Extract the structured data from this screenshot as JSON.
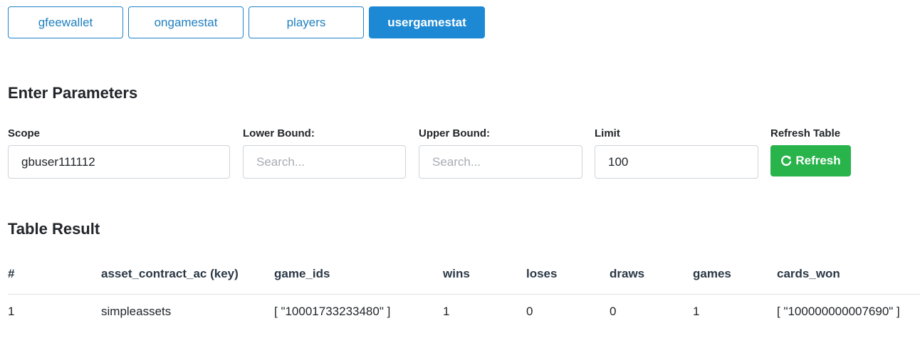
{
  "tabs": [
    {
      "label": "gfeewallet",
      "active": false
    },
    {
      "label": "ongamestat",
      "active": false
    },
    {
      "label": "players",
      "active": false
    },
    {
      "label": "usergamestat",
      "active": true
    }
  ],
  "params": {
    "title": "Enter Parameters",
    "scope": {
      "label": "Scope",
      "value": "gbuser111112",
      "placeholder": ""
    },
    "lower_bound": {
      "label": "Lower Bound:",
      "value": "",
      "placeholder": "Search..."
    },
    "upper_bound": {
      "label": "Upper Bound:",
      "value": "",
      "placeholder": "Search..."
    },
    "limit": {
      "label": "Limit",
      "value": "100",
      "placeholder": ""
    },
    "refresh": {
      "label": "Refresh Table",
      "button_label": "Refresh",
      "icon": "refresh-icon"
    }
  },
  "result": {
    "title": "Table Result",
    "columns": [
      "#",
      "asset_contract_ac (key)",
      "game_ids",
      "wins",
      "loses",
      "draws",
      "games",
      "cards_won"
    ],
    "rows": [
      [
        "1",
        "simpleassets",
        "[ \"10001733233480\" ]",
        "1",
        "0",
        "0",
        "1",
        "[ \"100000000007690\" ]"
      ]
    ]
  },
  "colors": {
    "tab_border": "#1f84c9",
    "tab_active_bg": "#1d89d4",
    "refresh_bg": "#28b34b"
  }
}
